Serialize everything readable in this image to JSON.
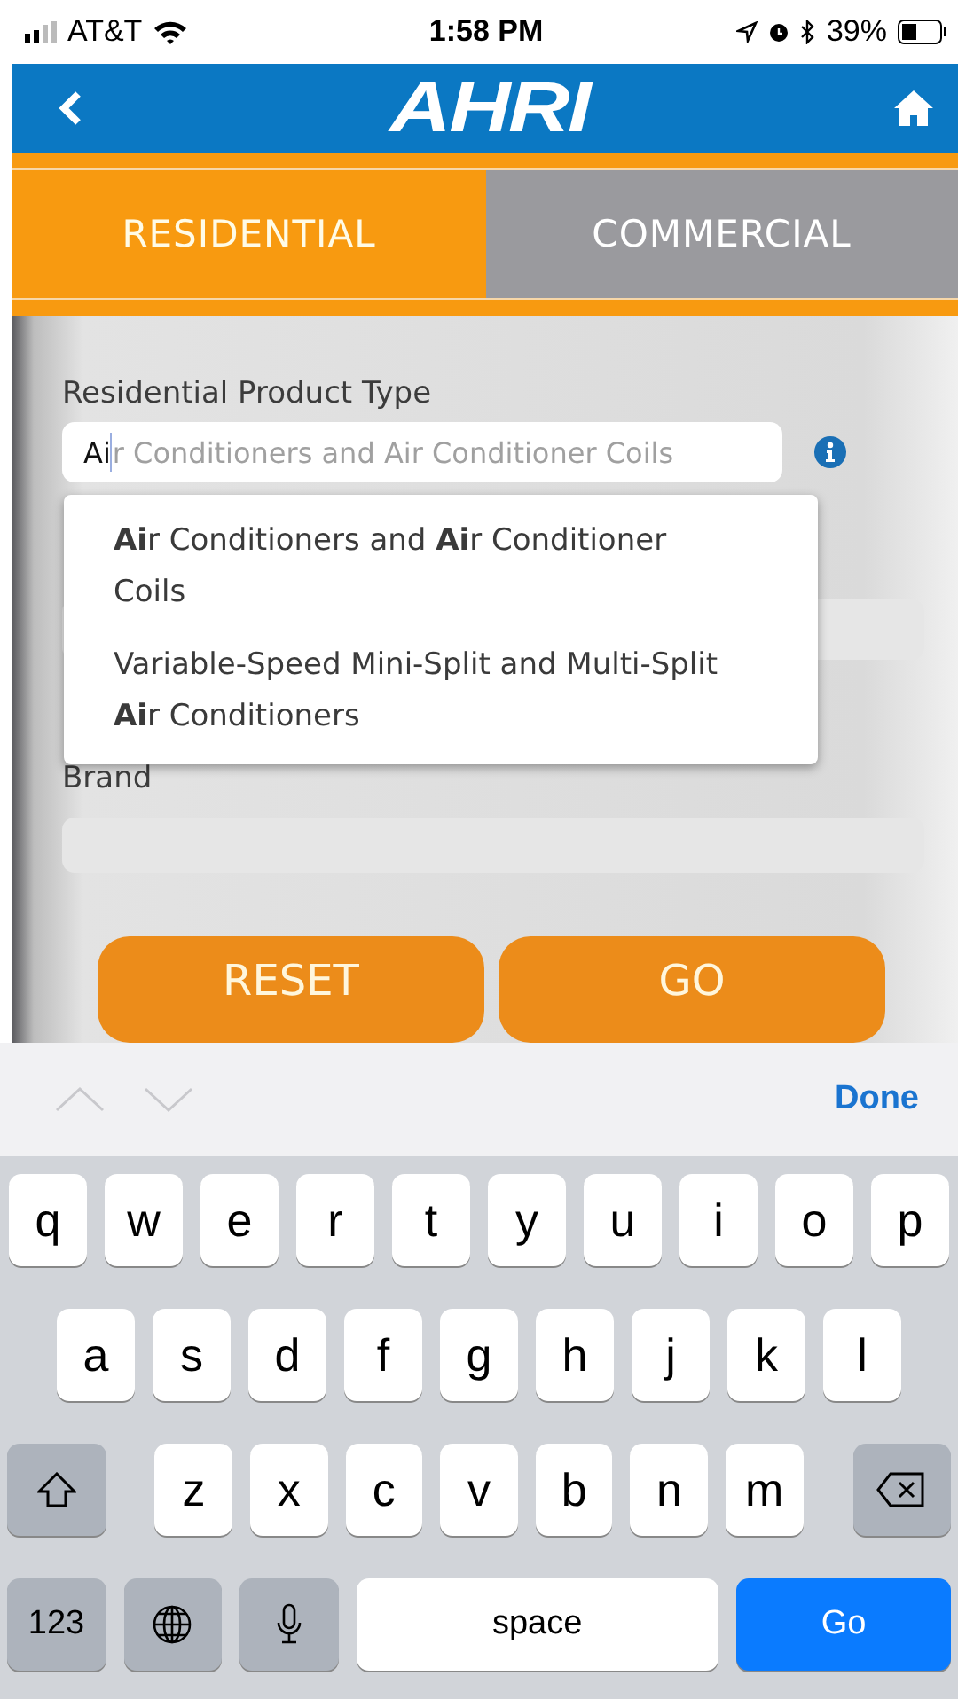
{
  "status_bar": {
    "carrier": "AT&T",
    "time": "1:58 PM",
    "battery": "39%"
  },
  "header": {
    "logo": "AHRI"
  },
  "tabs": [
    {
      "label": "RESIDENTIAL",
      "selected": true
    },
    {
      "label": "COMMERCIAL",
      "selected": false
    }
  ],
  "form": {
    "product_type": {
      "label": "Residential Product Type",
      "value": "Ai",
      "completion": "r Conditioners and Air Conditioner Coils"
    },
    "suggestions": [
      "**Ai**r Conditioners and **Ai**r Conditioner Coils",
      "Variable-Speed Mini-Split and Multi-Split **Ai**r Conditioners"
    ],
    "brand": {
      "label": "Brand"
    },
    "buttons": [
      "RESET",
      "GO"
    ]
  },
  "keyboard": {
    "done": "Done",
    "rows": [
      [
        "q",
        "w",
        "e",
        "r",
        "t",
        "y",
        "u",
        "i",
        "o",
        "p"
      ],
      [
        "a",
        "s",
        "d",
        "f",
        "g",
        "h",
        "j",
        "k",
        "l"
      ],
      [
        "z",
        "x",
        "c",
        "v",
        "b",
        "n",
        "m"
      ]
    ],
    "numbers": "123",
    "space": "space",
    "go": "Go"
  }
}
